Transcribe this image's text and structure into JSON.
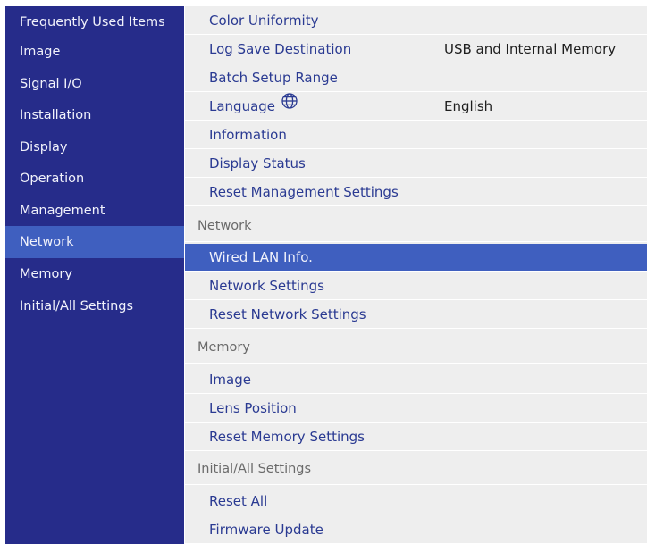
{
  "colors": {
    "sidebar_bg": "#262c8a",
    "selection": "#3f5fbf",
    "panel_bg": "#eeeeee",
    "item_text": "#2a3a92",
    "header_text": "#6a6a6a"
  },
  "sidebar": {
    "items": [
      {
        "label": "Frequently Used Items"
      },
      {
        "label": "Image"
      },
      {
        "label": "Signal I/O"
      },
      {
        "label": "Installation"
      },
      {
        "label": "Display"
      },
      {
        "label": "Operation"
      },
      {
        "label": "Management"
      },
      {
        "label": "Network",
        "selected": true
      },
      {
        "label": "Memory"
      },
      {
        "label": "Initial/All Settings"
      }
    ]
  },
  "main": {
    "rows": [
      {
        "label": "Color Uniformity"
      },
      {
        "label": "Log Save Destination",
        "value": "USB and Internal Memory"
      },
      {
        "label": "Batch Setup Range"
      },
      {
        "label": "Language",
        "icon": "globe-icon",
        "value": "English"
      },
      {
        "label": "Information"
      },
      {
        "label": "Display Status"
      },
      {
        "label": "Reset Management Settings"
      },
      {
        "label": "Network",
        "header": true
      },
      {
        "label": "Wired LAN Info.",
        "selected": true
      },
      {
        "label": "Network Settings"
      },
      {
        "label": "Reset Network Settings"
      },
      {
        "label": "Memory",
        "header": true
      },
      {
        "label": "Image"
      },
      {
        "label": "Lens Position"
      },
      {
        "label": "Reset Memory Settings"
      },
      {
        "label": "Initial/All Settings",
        "header": true
      },
      {
        "label": "Reset All"
      },
      {
        "label": "Firmware Update"
      }
    ]
  }
}
